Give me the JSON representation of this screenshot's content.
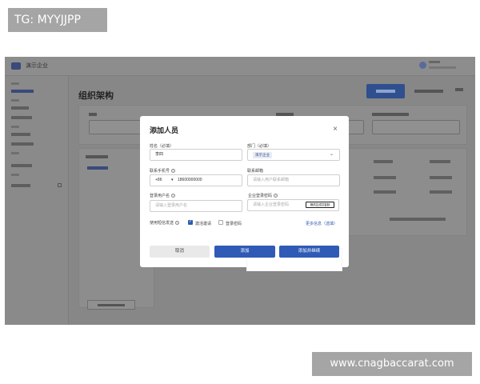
{
  "watermarks": {
    "top_left": "TG: MYYJJPP",
    "bottom_right": "www.cnagbaccarat.com"
  },
  "app": {
    "name": "演示企业",
    "page_title": "组织架构"
  },
  "modal": {
    "title": "添加人员",
    "close_icon": "×",
    "fields": {
      "name_label": "姓名（必填）",
      "name_value": "李四",
      "dept_label": "部门（必填）",
      "dept_value": "演示企业",
      "phone_label": "联系手机号",
      "phone_prefix": "+86",
      "phone_sep": "▾",
      "phone_value": "18600000000",
      "email_label": "联系邮箱",
      "email_placeholder": "请输入用户联系邮箱",
      "username_label": "登录用户名",
      "username_placeholder": "请输入登录用户名",
      "password_label": "企业登录密码",
      "password_placeholder": "请输入企业登录密码",
      "gen_password_button": "随机生成并复制",
      "sms_label": "使用短信发送",
      "sms_option_invite": "激活邀请",
      "sms_option_password": "登录密码",
      "more_link": "更多信息（选填）"
    },
    "buttons": {
      "cancel": "取消",
      "add": "添加",
      "add_continue": "添加并继续"
    }
  },
  "colors": {
    "primary": "#2f5bb7",
    "overlay": "#878787"
  }
}
